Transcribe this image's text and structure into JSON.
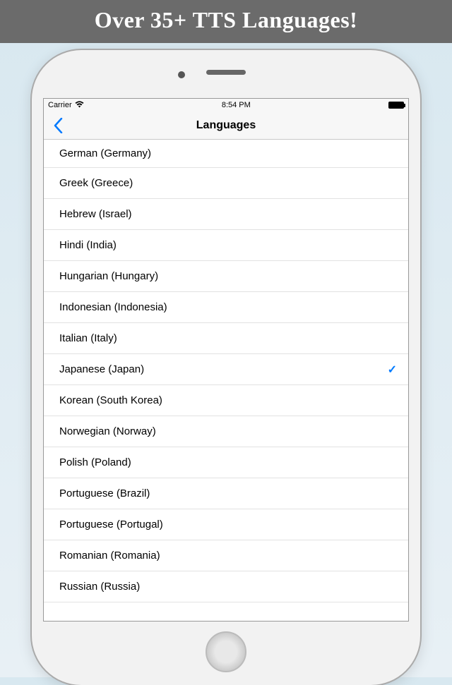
{
  "banner_text": "Over 35+ TTS Languages!",
  "status_bar": {
    "carrier": "Carrier",
    "time": "8:54 PM"
  },
  "nav": {
    "title": "Languages"
  },
  "languages": [
    {
      "label": "German (Germany)",
      "selected": false
    },
    {
      "label": "Greek (Greece)",
      "selected": false
    },
    {
      "label": "Hebrew (Israel)",
      "selected": false
    },
    {
      "label": "Hindi (India)",
      "selected": false
    },
    {
      "label": "Hungarian (Hungary)",
      "selected": false
    },
    {
      "label": "Indonesian (Indonesia)",
      "selected": false
    },
    {
      "label": "Italian (Italy)",
      "selected": false
    },
    {
      "label": "Japanese (Japan)",
      "selected": true
    },
    {
      "label": "Korean (South Korea)",
      "selected": false
    },
    {
      "label": "Norwegian (Norway)",
      "selected": false
    },
    {
      "label": "Polish (Poland)",
      "selected": false
    },
    {
      "label": "Portuguese (Brazil)",
      "selected": false
    },
    {
      "label": "Portuguese (Portugal)",
      "selected": false
    },
    {
      "label": "Romanian (Romania)",
      "selected": false
    },
    {
      "label": "Russian (Russia)",
      "selected": false
    }
  ]
}
